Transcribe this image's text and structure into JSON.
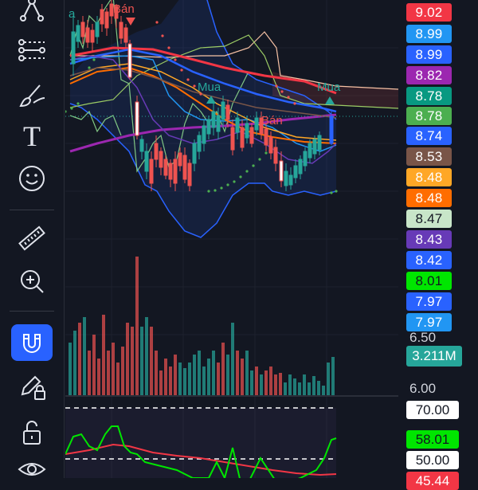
{
  "toolbar": {
    "tools": [
      {
        "name": "crosshair-tool",
        "icon": "node-icon",
        "active": false
      },
      {
        "name": "trendline-tool",
        "icon": "line-tool-icon",
        "active": false
      },
      {
        "name": "brush-tool",
        "icon": "brush-icon",
        "active": false
      },
      {
        "name": "text-tool",
        "icon": "text-icon",
        "active": false
      },
      {
        "name": "emoji-tool",
        "icon": "smiley-icon",
        "active": false
      },
      {
        "name": "ruler-tool",
        "icon": "ruler-icon",
        "active": false
      },
      {
        "name": "zoom-tool",
        "icon": "zoom-in-icon",
        "active": false
      },
      {
        "name": "magnet-tool",
        "icon": "magnet-icon",
        "active": true
      },
      {
        "name": "lock-drawing-tool",
        "icon": "pencil-lock-icon",
        "active": false
      },
      {
        "name": "unlock-tool",
        "icon": "unlock-icon",
        "active": false
      },
      {
        "name": "visibility-tool",
        "icon": "eye-icon",
        "active": false
      }
    ],
    "text_tool_glyph": "T",
    "active_color": "#2962ff"
  },
  "chart": {
    "signals": {
      "buy_label": "Mua",
      "sell_label": "Bán",
      "buy_color": "#26a69a",
      "sell_color": "#ef5350",
      "partial_top_label": "a"
    }
  },
  "price_scale": {
    "labels": [
      {
        "value": "9.02",
        "bg": "#f23645"
      },
      {
        "value": "8.99",
        "bg": "#2196f3"
      },
      {
        "value": "8.99",
        "bg": "#2962ff"
      },
      {
        "value": "8.82",
        "bg": "#9c27b0"
      },
      {
        "value": "8.78",
        "bg": "#089981"
      },
      {
        "value": "8.78",
        "bg": "#4caf50"
      },
      {
        "value": "8.74",
        "bg": "#2962ff"
      },
      {
        "value": "8.53",
        "bg": "#795548"
      },
      {
        "value": "8.48",
        "bg": "#ffa726"
      },
      {
        "value": "8.48",
        "bg": "#ff6d00"
      },
      {
        "value": "8.47",
        "bg": "#c8e6c9"
      },
      {
        "value": "8.43",
        "bg": "#673ab7"
      },
      {
        "value": "8.42",
        "bg": "#2962ff"
      },
      {
        "value": "8.01",
        "bg": "#00e600"
      },
      {
        "value": "7.97",
        "bg": "#2962ff"
      },
      {
        "value": "7.97",
        "bg": "#2196f3"
      }
    ],
    "axis_tick_650": "6.50",
    "axis_tick_600": "6.00",
    "volume_label": "3.211M"
  },
  "rsi": {
    "upper_band": "70.00",
    "rsi_value": "58.01",
    "middle_band": "50.00",
    "rsi_ma_value": "45.44",
    "rsi_color": "#00e600",
    "ma_color": "#f23645"
  }
}
